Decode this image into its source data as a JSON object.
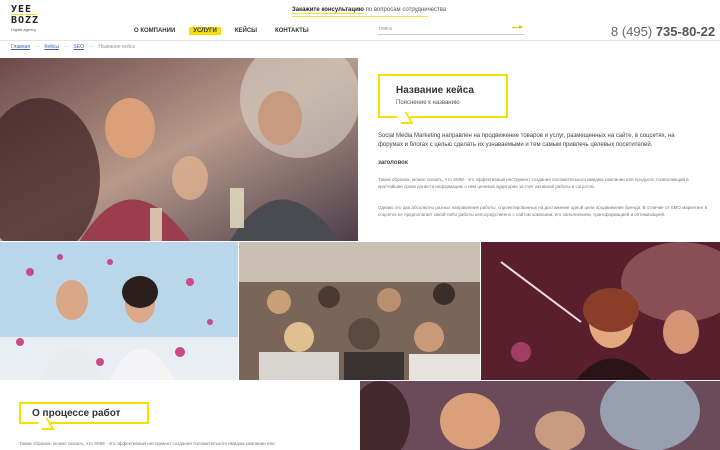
{
  "logo": {
    "line1": "УЕЕ",
    "line2": "ВОZZ",
    "tagline": "Digital agency"
  },
  "consult": {
    "link": "Закажите консультацию",
    "rest": "по вопросам сотрудничества"
  },
  "nav": [
    {
      "label": "О компании"
    },
    {
      "label": "Услуги"
    },
    {
      "label": "Кейсы"
    },
    {
      "label": "Контакты"
    }
  ],
  "search": {
    "placeholder": "поиск"
  },
  "phone": {
    "prefix": "8 (495)",
    "number": "735-80-22"
  },
  "breadcrumbs": [
    "Главная",
    "Кейсы",
    "SEO",
    "Название кейса"
  ],
  "case": {
    "title": "Название кейса",
    "subtitle": "Пояснение к названию",
    "lead": "Social Media Marketing направлен на продвижение товаров и услуг, размещенных на сайте, в соцсетях, на форумах и блогах с целью сделать их узнаваемыми и тем самым привлечь целевых посетителей.",
    "heading": "заголовок",
    "para1": "Таким образом, можно сказать, что SMM - это эффективный инструмент создания положительного имиджа компании или продукта, позволяющий в кратчайшие сроки донести информацию о нем целевой аудитории за счет активной работы в соцсетях.",
    "para2": "Однако это два абсолютно разных направления работы, спроектированных на достижение одной цели продвижения бренда. В отличие от SMO маркетинг в соцсетях не предполагает какой-либо работы непосредственно с сайтом компании, его наполнением, трансформацией и оптимизацией."
  },
  "process": {
    "title": "О процессе работ",
    "text": "Таким образом, можно сказать, что SMM - это эффективный инструмент создания положительного имиджа компании или"
  },
  "colors": {
    "accent": "#f5e000",
    "link": "#3a62b0"
  }
}
